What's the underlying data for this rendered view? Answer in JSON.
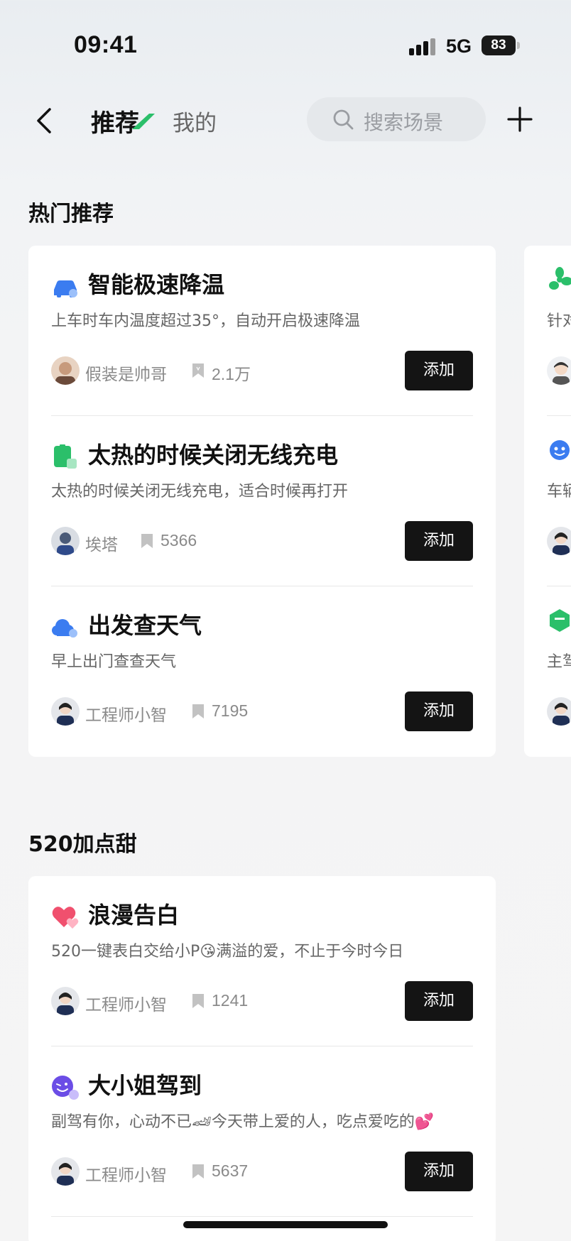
{
  "status": {
    "time": "09:41",
    "network": "5G",
    "battery": "83"
  },
  "nav": {
    "tab_recommend": "推荐",
    "tab_mine": "我的",
    "search_placeholder": "搜索场景"
  },
  "sections": {
    "hot_title": "热门推荐",
    "sweet_title": "520加点甜"
  },
  "hot_items": [
    {
      "title": "智能极速降温",
      "desc": "上车时车内温度超过35°，自动开启极速降温",
      "author": "假装是帅哥",
      "count": "2.1万",
      "button": "添加",
      "icon": "car-ac-icon"
    },
    {
      "title": "太热的时候关闭无线充电",
      "desc": "太热的时候关闭无线充电，适合时候再打开",
      "author": "埃塔",
      "count": "5366",
      "button": "添加",
      "icon": "wireless-charge-icon"
    },
    {
      "title": "出发查天气",
      "desc": "早上出门查查天气",
      "author": "工程师小智",
      "count": "7195",
      "button": "添加",
      "icon": "weather-icon"
    }
  ],
  "sweet_items": [
    {
      "title": "浪漫告白",
      "desc": "520一键表白交给小P😘满溢的爱，不止于今时今日",
      "author": "工程师小智",
      "count": "1241",
      "button": "添加",
      "icon": "hearts-icon"
    },
    {
      "title": "大小姐驾到",
      "desc": "副驾有你，心动不已🏎今天带上爱的人，吃点爱吃的💕",
      "author": "工程师小智",
      "count": "5637",
      "button": "添加",
      "icon": "wink-face-icon"
    }
  ],
  "peek_items": [
    {
      "text": "针对"
    },
    {
      "text": "车辆"
    },
    {
      "text": "主驾"
    }
  ],
  "colors": {
    "button_bg": "#141414",
    "accent_green": "#2bbf6a",
    "icon_blue": "#3b7cf0"
  }
}
